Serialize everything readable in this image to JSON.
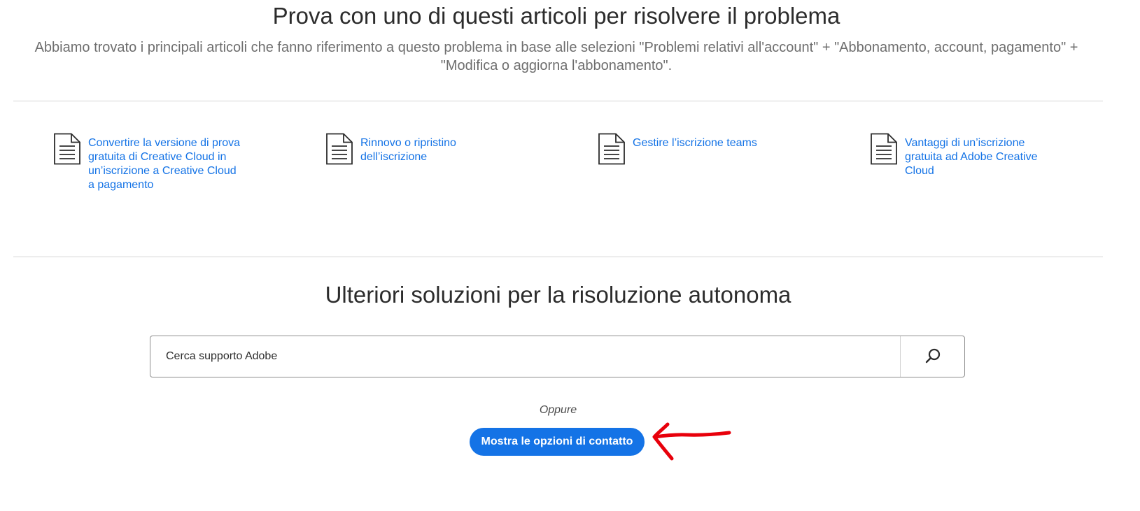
{
  "header": {
    "title": "Prova con uno di questi articoli per risolvere il problema",
    "subtitle": "Abbiamo trovato i principali articoli che fanno riferimento a questo problema in base alle selezioni \"Problemi relativi all'account\" + \"Abbonamento, account, pagamento\" + \"Modifica o aggiorna l'abbonamento\"."
  },
  "articles": [
    {
      "icon": "document-icon",
      "label": "Convertire la versione di prova gratuita di Creative Cloud in un’iscrizione a Creative Cloud a pagamento"
    },
    {
      "icon": "document-icon",
      "label": "Rinnovo o ripristino dell’iscrizione"
    },
    {
      "icon": "document-icon",
      "label": "Gestire l’iscrizione teams"
    },
    {
      "icon": "document-icon",
      "label": "Vantaggi di un’iscrizione gratuita ad Adobe Creative Cloud"
    }
  ],
  "self_help": {
    "title": "Ulteriori soluzioni per la risoluzione autonoma",
    "search": {
      "placeholder": "Cerca supporto Adobe",
      "value": "",
      "button_icon": "search-icon"
    },
    "separator_text": "Oppure",
    "contact_button_label": "Mostra le opzioni di contatto"
  },
  "colors": {
    "link": "#1473e6",
    "button_bg": "#1473e6",
    "annotation": "#e8000b"
  }
}
